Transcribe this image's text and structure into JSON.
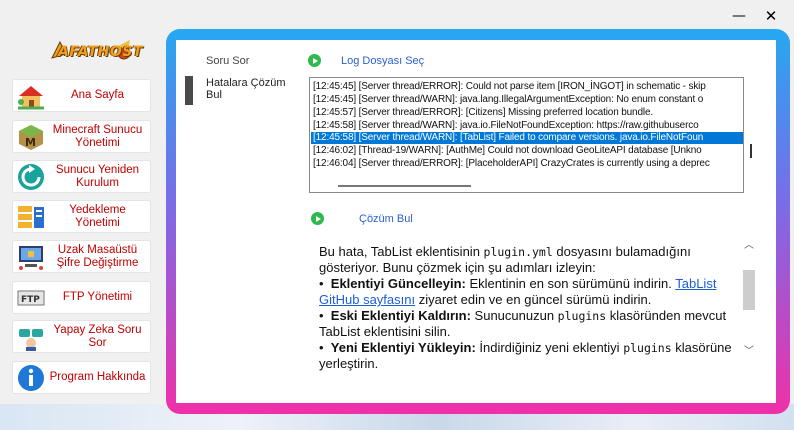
{
  "window": {
    "minimize": "—",
    "close": "✕"
  },
  "logo": {
    "text": "AFATHOST"
  },
  "nav": [
    {
      "label": "Ana Sayfa",
      "icon": "house-icon"
    },
    {
      "label": "Minecraft Sunucu Yönetimi",
      "icon": "minecraft-icon"
    },
    {
      "label": "Sunucu Yeniden Kurulum",
      "icon": "refresh-icon"
    },
    {
      "label": "Yedekleme Yönetimi",
      "icon": "folders-icon"
    },
    {
      "label": "Uzak Masaüstü Şifre Değiştirme",
      "icon": "remote-desktop-icon"
    },
    {
      "label": "FTP Yönetimi",
      "icon": "ftp-icon"
    },
    {
      "label": "Yapay Zeka Soru Sor",
      "icon": "ai-robot-icon"
    },
    {
      "label": "Program Hakkında",
      "icon": "info-icon"
    }
  ],
  "panel": {
    "side_soru": "Soru Sor",
    "side_hata": "Hatalara Çözüm Bul",
    "log_select_label": "Log Dosyası Seç",
    "solution_label": "Çözüm Bul"
  },
  "log_lines": [
    "[12:45:45] [Server thread/ERROR]: Could not parse item [IRON_İNGOT] in schematic - skip",
    "[12:45:45] [Server thread/WARN]: java.lang.IllegalArgumentException: No enum constant o",
    "[12:45:57] [Server thread/ERROR]: [Citizens] Missing preferred location bundle.",
    "[12:45:58] [Server thread/WARN]: java.io.FileNotFoundException: https://raw.githubuserco",
    "[12:45:58] [Server thread/WARN]: [TabList] Failed to compare versions. java.io.FileNotFoun",
    "[12:46:02] [Thread-19/WARN]: [AuthMe] Could not download GeoLiteAPI database [Unkno",
    "[12:46:04] [Server thread/ERROR]: [PlaceholderAPI] CrazyCrates is currently using a deprec"
  ],
  "selected_log_index": 4,
  "answer": {
    "intro_a": "Bu hata, TabList eklentisinin ",
    "intro_code": "plugin.yml",
    "intro_b": " dosyasını bulamadığını gösteriyor. Bunu çözmek için şu adımları izleyin:",
    "b1_bold": "Eklentiyi Güncelleyin:",
    "b1_text": " Eklentinin en son sürümünü indirin.",
    "b1_link": "TabList GitHub sayfasını",
    "b1_after": " ziyaret edin ve en güncel sürümü indirin.",
    "b2_bold": "Eski Eklentiyi Kaldırın:",
    "b2_text": " Sunucunuzun ",
    "b2_code": "plugins",
    "b2_after": " klasöründen mevcut TabList eklentisini silin.",
    "b3_bold": "Yeni Eklentiyi Yükleyin:",
    "b3_text": " İndirdiğiniz yeni eklentiyi ",
    "b3_code": "plugins",
    "b3_after": " klasörüne yerleştirin."
  }
}
